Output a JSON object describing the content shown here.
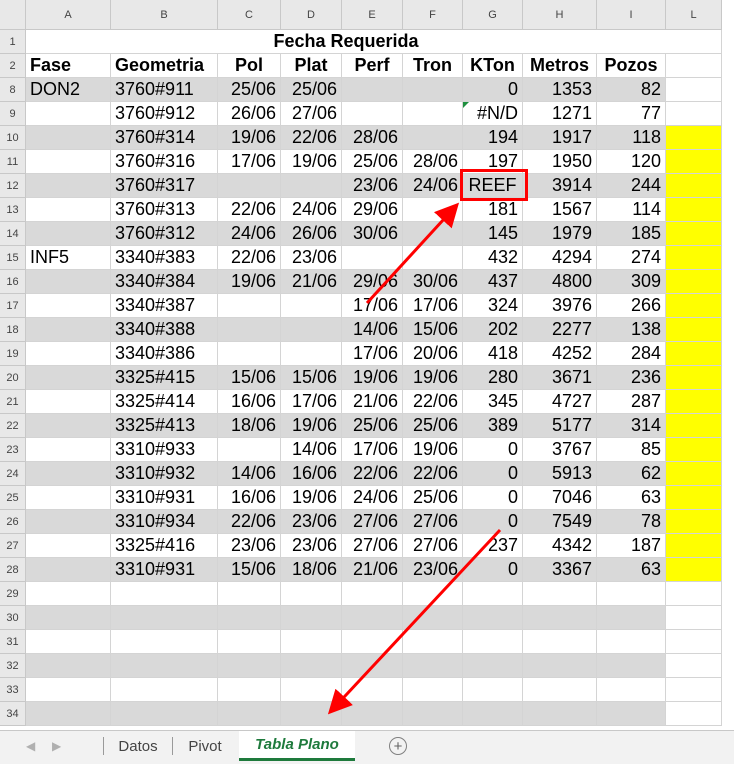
{
  "columns": [
    "A",
    "B",
    "C",
    "D",
    "E",
    "F",
    "G",
    "H",
    "I",
    "L"
  ],
  "title": "Fecha Requerida",
  "header": {
    "row_number": "2",
    "cells": [
      "Fase",
      "Geometria",
      "Pol",
      "Plat",
      "Perf",
      "Tron",
      "KTon",
      "Metros",
      "Pozos"
    ]
  },
  "rows": [
    {
      "num": "8",
      "cells": [
        "DON2",
        "3760#911",
        "25/06",
        "25/06",
        "",
        "",
        "0",
        "1353",
        "82"
      ]
    },
    {
      "num": "9",
      "cells": [
        "",
        "3760#912",
        "26/06",
        "27/06",
        "",
        "",
        "#N/D",
        "1271",
        "77"
      ]
    },
    {
      "num": "10",
      "cells": [
        "",
        "3760#314",
        "19/06",
        "22/06",
        "28/06",
        "",
        "194",
        "1917",
        "118"
      ]
    },
    {
      "num": "11",
      "cells": [
        "",
        "3760#316",
        "17/06",
        "19/06",
        "25/06",
        "28/06",
        "197",
        "1950",
        "120"
      ]
    },
    {
      "num": "12",
      "cells": [
        "",
        "3760#317",
        "",
        "",
        "23/06",
        "24/06",
        "REEF",
        "3914",
        "244"
      ]
    },
    {
      "num": "13",
      "cells": [
        "",
        "3760#313",
        "22/06",
        "24/06",
        "29/06",
        "",
        "181",
        "1567",
        "114"
      ]
    },
    {
      "num": "14",
      "cells": [
        "",
        "3760#312",
        "24/06",
        "26/06",
        "30/06",
        "",
        "145",
        "1979",
        "185"
      ]
    },
    {
      "num": "15",
      "cells": [
        "INF5",
        "3340#383",
        "22/06",
        "23/06",
        "",
        "",
        "432",
        "4294",
        "274"
      ]
    },
    {
      "num": "16",
      "cells": [
        "",
        "3340#384",
        "19/06",
        "21/06",
        "29/06",
        "30/06",
        "437",
        "4800",
        "309"
      ]
    },
    {
      "num": "17",
      "cells": [
        "",
        "3340#387",
        "",
        "",
        "17/06",
        "17/06",
        "324",
        "3976",
        "266"
      ]
    },
    {
      "num": "18",
      "cells": [
        "",
        "3340#388",
        "",
        "",
        "14/06",
        "15/06",
        "202",
        "2277",
        "138"
      ]
    },
    {
      "num": "19",
      "cells": [
        "",
        "3340#386",
        "",
        "",
        "17/06",
        "20/06",
        "418",
        "4252",
        "284"
      ]
    },
    {
      "num": "20",
      "cells": [
        "",
        "3325#415",
        "15/06",
        "15/06",
        "19/06",
        "19/06",
        "280",
        "3671",
        "236"
      ]
    },
    {
      "num": "21",
      "cells": [
        "",
        "3325#414",
        "16/06",
        "17/06",
        "21/06",
        "22/06",
        "345",
        "4727",
        "287"
      ]
    },
    {
      "num": "22",
      "cells": [
        "",
        "3325#413",
        "18/06",
        "19/06",
        "25/06",
        "25/06",
        "389",
        "5177",
        "314"
      ]
    },
    {
      "num": "23",
      "cells": [
        "",
        "3310#933",
        "",
        "14/06",
        "17/06",
        "19/06",
        "0",
        "3767",
        "85"
      ]
    },
    {
      "num": "24",
      "cells": [
        "",
        "3310#932",
        "14/06",
        "16/06",
        "22/06",
        "22/06",
        "0",
        "5913",
        "62"
      ]
    },
    {
      "num": "25",
      "cells": [
        "",
        "3310#931",
        "16/06",
        "19/06",
        "24/06",
        "25/06",
        "0",
        "7046",
        "63"
      ]
    },
    {
      "num": "26",
      "cells": [
        "",
        "3310#934",
        "22/06",
        "23/06",
        "27/06",
        "27/06",
        "0",
        "7549",
        "78"
      ]
    },
    {
      "num": "27",
      "cells": [
        "",
        "3325#416",
        "23/06",
        "23/06",
        "27/06",
        "27/06",
        "237",
        "4342",
        "187"
      ]
    },
    {
      "num": "28",
      "cells": [
        "",
        "3310#931",
        "15/06",
        "18/06",
        "21/06",
        "23/06",
        "0",
        "3367",
        "63"
      ]
    },
    {
      "num": "29",
      "cells": [
        "",
        "",
        "",
        "",
        "",
        "",
        "",
        "",
        ""
      ]
    },
    {
      "num": "30",
      "cells": [
        "",
        "",
        "",
        "",
        "",
        "",
        "",
        "",
        ""
      ]
    },
    {
      "num": "31",
      "cells": [
        "",
        "",
        "",
        "",
        "",
        "",
        "",
        "",
        ""
      ]
    },
    {
      "num": "32",
      "cells": [
        "",
        "",
        "",
        "",
        "",
        "",
        "",
        "",
        ""
      ]
    },
    {
      "num": "33",
      "cells": [
        "",
        "",
        "",
        "",
        "",
        "",
        "",
        "",
        ""
      ]
    },
    {
      "num": "34",
      "cells": [
        "",
        "",
        "",
        "",
        "",
        "",
        "",
        "",
        ""
      ]
    }
  ],
  "title_row_number": "1",
  "highlight_cell": "REEF",
  "colors": {
    "row_shade": "#d9d9d9",
    "highlight_fill": "#ffff00",
    "annotation": "#ff0000",
    "active_tab": "#1e7a3c"
  },
  "tabs": [
    {
      "label": "Datos",
      "active": false
    },
    {
      "label": "Pivot",
      "active": false
    },
    {
      "label": "Tabla Plano",
      "active": true
    }
  ],
  "icons": {
    "prev": "chevron-left-icon",
    "next": "chevron-right-icon",
    "add": "add-sheet-icon"
  }
}
